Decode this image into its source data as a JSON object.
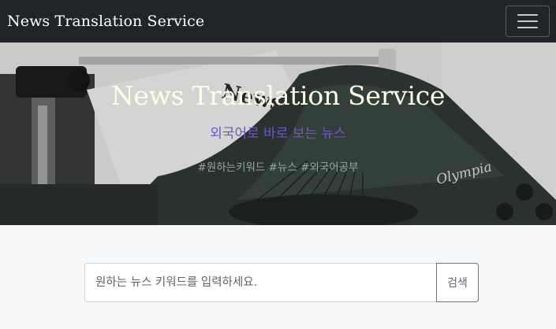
{
  "navbar": {
    "brand": "News Translation Service",
    "menu_icon": "hamburger-menu-icon"
  },
  "hero": {
    "title": "News Translation Service",
    "subtitle": "외국어로 바로 보는 뉴스",
    "tags": "#원하는키워드 #뉴스 #외국어공부",
    "colors": {
      "title": "#fffde8",
      "subtitle": "#6f56c9",
      "tags": "#8fa8a0"
    }
  },
  "search": {
    "placeholder": "원하는 뉴스 키워드를 입력하세요.",
    "button_label": "검색"
  }
}
